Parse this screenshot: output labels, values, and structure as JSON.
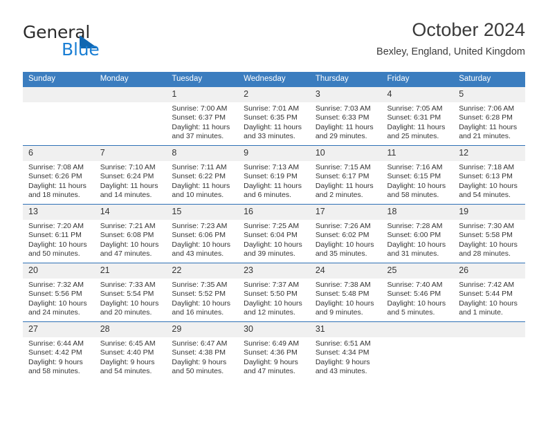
{
  "logo": {
    "word_one": "General",
    "word_two": "Blue",
    "triangle_color": "#1167b1",
    "blue_color": "#1b7fd4",
    "icon": "general-blue-logo"
  },
  "header": {
    "title": "October 2024",
    "subtitle": "Bexley, England, United Kingdom"
  },
  "theme": {
    "header_blue": "#3b7dbf",
    "row_rule": "#2d6fb5",
    "daynum_band": "#f0f0f0"
  },
  "weekday_headers": [
    "Sunday",
    "Monday",
    "Tuesday",
    "Wednesday",
    "Thursday",
    "Friday",
    "Saturday"
  ],
  "weeks": [
    [
      {
        "day": "",
        "sunrise": "",
        "sunset": "",
        "daylight1": "",
        "daylight2": ""
      },
      {
        "day": "",
        "sunrise": "",
        "sunset": "",
        "daylight1": "",
        "daylight2": ""
      },
      {
        "day": "1",
        "sunrise": "Sunrise: 7:00 AM",
        "sunset": "Sunset: 6:37 PM",
        "daylight1": "Daylight: 11 hours",
        "daylight2": "and 37 minutes."
      },
      {
        "day": "2",
        "sunrise": "Sunrise: 7:01 AM",
        "sunset": "Sunset: 6:35 PM",
        "daylight1": "Daylight: 11 hours",
        "daylight2": "and 33 minutes."
      },
      {
        "day": "3",
        "sunrise": "Sunrise: 7:03 AM",
        "sunset": "Sunset: 6:33 PM",
        "daylight1": "Daylight: 11 hours",
        "daylight2": "and 29 minutes."
      },
      {
        "day": "4",
        "sunrise": "Sunrise: 7:05 AM",
        "sunset": "Sunset: 6:31 PM",
        "daylight1": "Daylight: 11 hours",
        "daylight2": "and 25 minutes."
      },
      {
        "day": "5",
        "sunrise": "Sunrise: 7:06 AM",
        "sunset": "Sunset: 6:28 PM",
        "daylight1": "Daylight: 11 hours",
        "daylight2": "and 21 minutes."
      }
    ],
    [
      {
        "day": "6",
        "sunrise": "Sunrise: 7:08 AM",
        "sunset": "Sunset: 6:26 PM",
        "daylight1": "Daylight: 11 hours",
        "daylight2": "and 18 minutes."
      },
      {
        "day": "7",
        "sunrise": "Sunrise: 7:10 AM",
        "sunset": "Sunset: 6:24 PM",
        "daylight1": "Daylight: 11 hours",
        "daylight2": "and 14 minutes."
      },
      {
        "day": "8",
        "sunrise": "Sunrise: 7:11 AM",
        "sunset": "Sunset: 6:22 PM",
        "daylight1": "Daylight: 11 hours",
        "daylight2": "and 10 minutes."
      },
      {
        "day": "9",
        "sunrise": "Sunrise: 7:13 AM",
        "sunset": "Sunset: 6:19 PM",
        "daylight1": "Daylight: 11 hours",
        "daylight2": "and 6 minutes."
      },
      {
        "day": "10",
        "sunrise": "Sunrise: 7:15 AM",
        "sunset": "Sunset: 6:17 PM",
        "daylight1": "Daylight: 11 hours",
        "daylight2": "and 2 minutes."
      },
      {
        "day": "11",
        "sunrise": "Sunrise: 7:16 AM",
        "sunset": "Sunset: 6:15 PM",
        "daylight1": "Daylight: 10 hours",
        "daylight2": "and 58 minutes."
      },
      {
        "day": "12",
        "sunrise": "Sunrise: 7:18 AM",
        "sunset": "Sunset: 6:13 PM",
        "daylight1": "Daylight: 10 hours",
        "daylight2": "and 54 minutes."
      }
    ],
    [
      {
        "day": "13",
        "sunrise": "Sunrise: 7:20 AM",
        "sunset": "Sunset: 6:11 PM",
        "daylight1": "Daylight: 10 hours",
        "daylight2": "and 50 minutes."
      },
      {
        "day": "14",
        "sunrise": "Sunrise: 7:21 AM",
        "sunset": "Sunset: 6:08 PM",
        "daylight1": "Daylight: 10 hours",
        "daylight2": "and 47 minutes."
      },
      {
        "day": "15",
        "sunrise": "Sunrise: 7:23 AM",
        "sunset": "Sunset: 6:06 PM",
        "daylight1": "Daylight: 10 hours",
        "daylight2": "and 43 minutes."
      },
      {
        "day": "16",
        "sunrise": "Sunrise: 7:25 AM",
        "sunset": "Sunset: 6:04 PM",
        "daylight1": "Daylight: 10 hours",
        "daylight2": "and 39 minutes."
      },
      {
        "day": "17",
        "sunrise": "Sunrise: 7:26 AM",
        "sunset": "Sunset: 6:02 PM",
        "daylight1": "Daylight: 10 hours",
        "daylight2": "and 35 minutes."
      },
      {
        "day": "18",
        "sunrise": "Sunrise: 7:28 AM",
        "sunset": "Sunset: 6:00 PM",
        "daylight1": "Daylight: 10 hours",
        "daylight2": "and 31 minutes."
      },
      {
        "day": "19",
        "sunrise": "Sunrise: 7:30 AM",
        "sunset": "Sunset: 5:58 PM",
        "daylight1": "Daylight: 10 hours",
        "daylight2": "and 28 minutes."
      }
    ],
    [
      {
        "day": "20",
        "sunrise": "Sunrise: 7:32 AM",
        "sunset": "Sunset: 5:56 PM",
        "daylight1": "Daylight: 10 hours",
        "daylight2": "and 24 minutes."
      },
      {
        "day": "21",
        "sunrise": "Sunrise: 7:33 AM",
        "sunset": "Sunset: 5:54 PM",
        "daylight1": "Daylight: 10 hours",
        "daylight2": "and 20 minutes."
      },
      {
        "day": "22",
        "sunrise": "Sunrise: 7:35 AM",
        "sunset": "Sunset: 5:52 PM",
        "daylight1": "Daylight: 10 hours",
        "daylight2": "and 16 minutes."
      },
      {
        "day": "23",
        "sunrise": "Sunrise: 7:37 AM",
        "sunset": "Sunset: 5:50 PM",
        "daylight1": "Daylight: 10 hours",
        "daylight2": "and 12 minutes."
      },
      {
        "day": "24",
        "sunrise": "Sunrise: 7:38 AM",
        "sunset": "Sunset: 5:48 PM",
        "daylight1": "Daylight: 10 hours",
        "daylight2": "and 9 minutes."
      },
      {
        "day": "25",
        "sunrise": "Sunrise: 7:40 AM",
        "sunset": "Sunset: 5:46 PM",
        "daylight1": "Daylight: 10 hours",
        "daylight2": "and 5 minutes."
      },
      {
        "day": "26",
        "sunrise": "Sunrise: 7:42 AM",
        "sunset": "Sunset: 5:44 PM",
        "daylight1": "Daylight: 10 hours",
        "daylight2": "and 1 minute."
      }
    ],
    [
      {
        "day": "27",
        "sunrise": "Sunrise: 6:44 AM",
        "sunset": "Sunset: 4:42 PM",
        "daylight1": "Daylight: 9 hours",
        "daylight2": "and 58 minutes."
      },
      {
        "day": "28",
        "sunrise": "Sunrise: 6:45 AM",
        "sunset": "Sunset: 4:40 PM",
        "daylight1": "Daylight: 9 hours",
        "daylight2": "and 54 minutes."
      },
      {
        "day": "29",
        "sunrise": "Sunrise: 6:47 AM",
        "sunset": "Sunset: 4:38 PM",
        "daylight1": "Daylight: 9 hours",
        "daylight2": "and 50 minutes."
      },
      {
        "day": "30",
        "sunrise": "Sunrise: 6:49 AM",
        "sunset": "Sunset: 4:36 PM",
        "daylight1": "Daylight: 9 hours",
        "daylight2": "and 47 minutes."
      },
      {
        "day": "31",
        "sunrise": "Sunrise: 6:51 AM",
        "sunset": "Sunset: 4:34 PM",
        "daylight1": "Daylight: 9 hours",
        "daylight2": "and 43 minutes."
      },
      {
        "day": "",
        "sunrise": "",
        "sunset": "",
        "daylight1": "",
        "daylight2": ""
      },
      {
        "day": "",
        "sunrise": "",
        "sunset": "",
        "daylight1": "",
        "daylight2": ""
      }
    ]
  ]
}
